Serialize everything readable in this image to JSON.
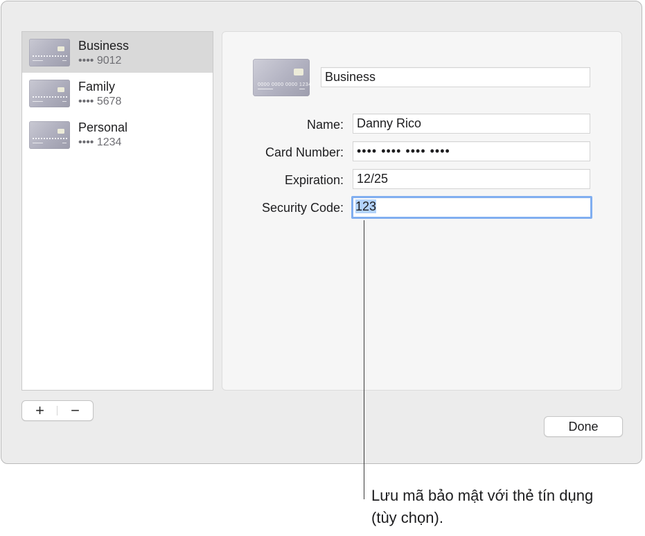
{
  "cards": [
    {
      "name": "Business",
      "last4": "•••• 9012"
    },
    {
      "name": "Family",
      "last4": "•••• 5678"
    },
    {
      "name": "Personal",
      "last4": "•••• 1234"
    }
  ],
  "list_controls": {
    "add": "+",
    "remove": "−"
  },
  "detail": {
    "card_thumb_number": "0000 0000 0000 1234",
    "card_title": "Business",
    "labels": {
      "name": "Name:",
      "card_number": "Card Number:",
      "expiration": "Expiration:",
      "security_code": "Security Code:"
    },
    "values": {
      "name": "Danny Rico",
      "card_number": "•••• •••• •••• ••••",
      "expiration": "12/25",
      "security_code": "123"
    }
  },
  "done_label": "Done",
  "callout": "Lưu mã bảo mật với thẻ tín dụng (tùy chọn).",
  "colors": {
    "focus_ring": "#80aef0",
    "selection": "#b3d3fb",
    "selected_row": "#d9d9d9"
  }
}
